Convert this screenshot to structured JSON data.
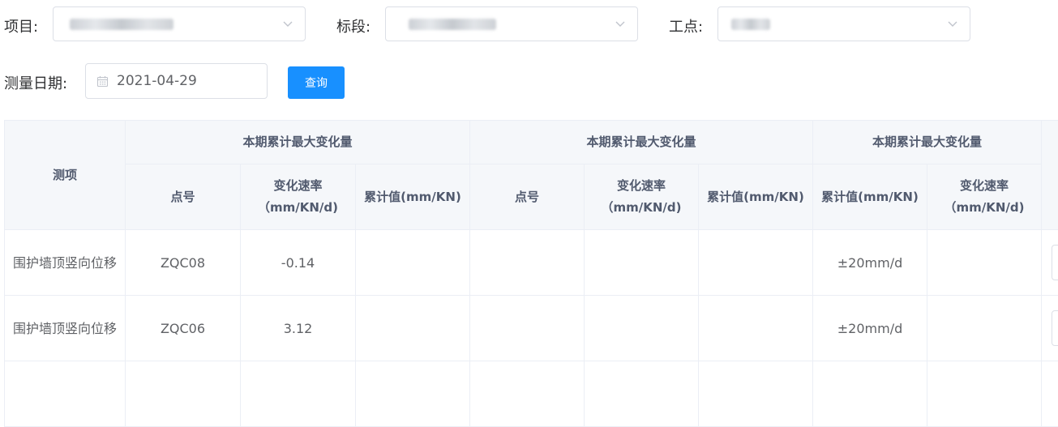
{
  "filters": {
    "project": {
      "label": "项目:"
    },
    "section": {
      "label": "标段:"
    },
    "site": {
      "label": "工点:"
    },
    "date": {
      "label": "测量日期:",
      "value": "2021-04-29"
    },
    "query_button": "查询"
  },
  "table": {
    "col_item": "测项",
    "group_headers": [
      "本期累计最大变化量",
      "本期累计最大变化量",
      "本期累计最大变化量"
    ],
    "sub_headers": [
      "点号",
      "变化速率（mm/KN/d)",
      "累计值(mm/KN)",
      "点号",
      "变化速率（mm/KN/d)",
      "累计值(mm/KN)",
      "累计值(mm/KN)",
      "变化速率（mm/KN/d)"
    ],
    "rows": [
      {
        "item": "围护墙顶竖向位移",
        "cells": [
          "ZQC08",
          "-0.14",
          "",
          "",
          "",
          "",
          "±20mm/d",
          ""
        ]
      },
      {
        "item": "围护墙顶竖向位移",
        "cells": [
          "ZQC06",
          "3.12",
          "",
          "",
          "",
          "",
          "±20mm/d",
          ""
        ]
      }
    ]
  },
  "colors": {
    "primary": "#1890ff",
    "header_bg": "#f5f7fa",
    "border": "#ebeef5"
  }
}
